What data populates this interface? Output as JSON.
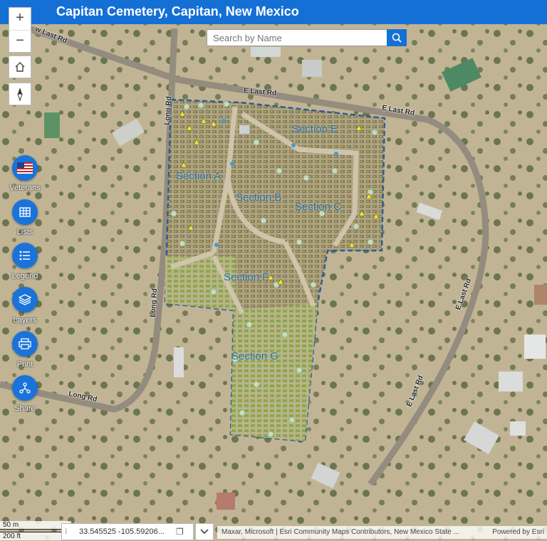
{
  "header": {
    "title": "Capitan Cemetery, Capitan, New Mexico"
  },
  "search": {
    "placeholder": "Search by Name"
  },
  "map_controls": {
    "zoom_in": "+",
    "zoom_out": "−"
  },
  "side_tools": [
    {
      "label": "Veterans",
      "icon": "us-flag-icon"
    },
    {
      "label": "Lists",
      "icon": "table-icon"
    },
    {
      "label": "Legend",
      "icon": "legend-list-icon"
    },
    {
      "label": "Layers",
      "icon": "layers-icon"
    },
    {
      "label": "Print",
      "icon": "printer-icon"
    },
    {
      "label": "Share",
      "icon": "share-icon"
    }
  ],
  "sections": [
    "Section A",
    "Section B",
    "Section C",
    "Section E",
    "Section F",
    "Section G"
  ],
  "roads": [
    "E Last Rd",
    "E Last Rd",
    "Long Rd",
    "Long Rd",
    "Long Rd",
    "E Last Rd",
    "E Last Rd",
    "w Last Rd"
  ],
  "scale_bar": {
    "metric": "50 m",
    "imperial": "200 ft"
  },
  "coordinates": "33.545525 -105.59206...",
  "attribution": {
    "text": "Maxar, Microsoft | Esri Community Maps Contributors, New Mexico State ...",
    "powered": "Powered by Esri"
  },
  "colors": {
    "header": "#1570d6",
    "boundary": "#1f4e8c",
    "section_label": "#2a6fa8",
    "button": "#1a73d9"
  }
}
